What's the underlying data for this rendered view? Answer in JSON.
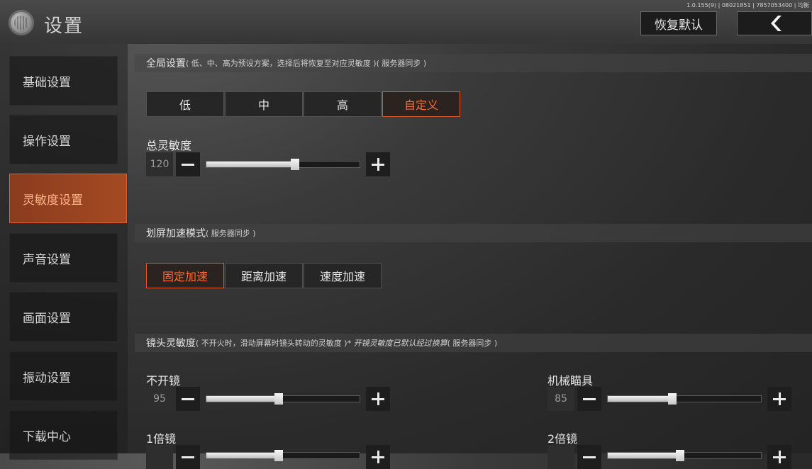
{
  "header": {
    "title": "设置",
    "version": "1.0.155(9) | 08021851 | 7857053400 | 均衡",
    "reset_label": "恢复默认",
    "back_icon": "chevron-left-icon"
  },
  "sidebar": {
    "items": [
      {
        "label": "基础设置"
      },
      {
        "label": "操作设置"
      },
      {
        "label": "灵敏度设置"
      },
      {
        "label": "声音设置"
      },
      {
        "label": "画面设置"
      },
      {
        "label": "振动设置"
      },
      {
        "label": "下载中心"
      }
    ],
    "active_index": 2
  },
  "global": {
    "title": "全局设置",
    "note": "( 低、中、高为预设方案，选择后将恢复至对应灵敏度 )( 服务器同步 )",
    "options": [
      "低",
      "中",
      "高",
      "自定义"
    ],
    "selected": "自定义",
    "total": {
      "label": "总灵敏度",
      "value": "120",
      "fraction": 0.58
    }
  },
  "swipe": {
    "title": "划屏加速模式",
    "note": "( 服务器同步 )",
    "options": [
      "固定加速",
      "距离加速",
      "速度加速"
    ],
    "selected": "固定加速"
  },
  "camera": {
    "title": "镜头灵敏度",
    "note": "( 不开火时，滑动屏幕时镜头转动的灵敏度 )",
    "note_italic": "* 开镜灵敏度已默认经过换算",
    "note_tail": "( 服务器同步 )",
    "sliders": [
      {
        "label": "不开镜",
        "value": "95",
        "fraction": 0.47
      },
      {
        "label": "机械瞄具",
        "value": "85",
        "fraction": 0.42
      },
      {
        "label": "1倍镜",
        "value": "",
        "fraction": 0.47
      },
      {
        "label": "2倍镜",
        "value": "",
        "fraction": 0.47
      }
    ]
  },
  "colors": {
    "accent": "#e0582a",
    "active_nav": "#a44a22"
  }
}
